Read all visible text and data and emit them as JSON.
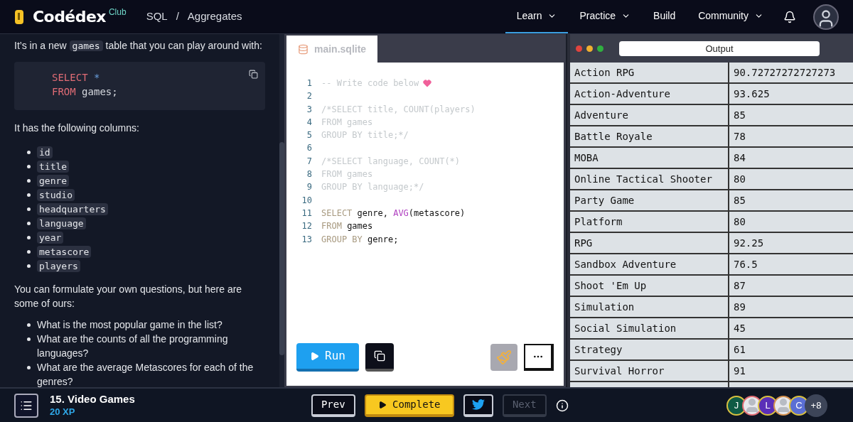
{
  "header": {
    "logo": "Codédex",
    "logo_badge": "Club",
    "breadcrumb": [
      "SQL",
      "Aggregates"
    ],
    "breadcrumb_separator": "/",
    "nav": [
      {
        "label": "Learn",
        "selected": true,
        "dropdown": true
      },
      {
        "label": "Practice",
        "selected": false,
        "dropdown": true
      },
      {
        "label": "Build",
        "selected": false,
        "dropdown": false
      },
      {
        "label": "Community",
        "selected": false,
        "dropdown": true
      }
    ]
  },
  "lesson": {
    "intro": [
      {
        "kind": "text",
        "text": "It’s in a new "
      },
      {
        "kind": "code",
        "text": "games"
      },
      {
        "kind": "text",
        "text": " table that you can play around with:"
      }
    ],
    "code_block": [
      [
        {
          "kind": "keyword",
          "text": "SELECT"
        },
        {
          "kind": "op",
          "text": "*"
        }
      ],
      [
        {
          "kind": "keyword",
          "text": "FROM"
        },
        {
          "kind": "plain",
          "text": "games;"
        }
      ]
    ],
    "columns_intro": "It has the following columns:",
    "columns": [
      "id",
      "title",
      "genre",
      "studio",
      "headquarters",
      "language",
      "year",
      "metascore",
      "players"
    ],
    "questions_intro": "You can formulate your own questions, but here are some of ours:",
    "questions": [
      "What is the most popular game in the list?",
      "What are the counts of all the programming languages?",
      "What are the average Metascores for each of the genres?"
    ]
  },
  "editor": {
    "tab": "main.sqlite",
    "lines": [
      {
        "number": "1",
        "tokens": [
          {
            "kind": "comment",
            "text": "-- Write code below"
          },
          {
            "kind": "heart"
          }
        ]
      },
      {
        "number": "2"
      },
      {
        "number": "3",
        "tokens": [
          {
            "kind": "comment",
            "text": "/*SELECT title, COUNT(players)"
          }
        ]
      },
      {
        "number": "4",
        "tokens": [
          {
            "kind": "comment",
            "text": "FROM games"
          }
        ]
      },
      {
        "number": "5",
        "tokens": [
          {
            "kind": "comment",
            "text": "GROUP BY title;*/"
          }
        ]
      },
      {
        "number": "6"
      },
      {
        "number": "7",
        "tokens": [
          {
            "kind": "comment",
            "text": "/*SELECT language, COUNT(*)"
          }
        ]
      },
      {
        "number": "8",
        "tokens": [
          {
            "kind": "comment",
            "text": "FROM games"
          }
        ]
      },
      {
        "number": "9",
        "tokens": [
          {
            "kind": "comment",
            "text": "GROUP BY language;*/"
          }
        ]
      },
      {
        "number": "10"
      },
      {
        "number": "11",
        "tokens": [
          {
            "kind": "keyword",
            "text": "SELECT"
          },
          {
            "kind": "plain",
            "text": " genre, "
          },
          {
            "kind": "func",
            "text": "AVG"
          },
          {
            "kind": "plain",
            "text": "(metascore)"
          }
        ]
      },
      {
        "number": "12",
        "tokens": [
          {
            "kind": "keyword",
            "text": "FROM"
          },
          {
            "kind": "plain",
            "text": " games"
          }
        ]
      },
      {
        "number": "13",
        "tokens": [
          {
            "kind": "keyword",
            "text": "GROUP BY"
          },
          {
            "kind": "plain",
            "text": " genre;"
          }
        ]
      }
    ],
    "run_button": "Run"
  },
  "output": {
    "title": "Output",
    "rows": [
      [
        "Action RPG",
        "90.72727272727273"
      ],
      [
        "Action-Adventure",
        "93.625"
      ],
      [
        "Adventure",
        "85"
      ],
      [
        "Battle Royale",
        "78"
      ],
      [
        "MOBA",
        "84"
      ],
      [
        "Online Tactical Shooter",
        "80"
      ],
      [
        "Party Game",
        "85"
      ],
      [
        "Platform",
        "80"
      ],
      [
        "RPG",
        "92.25"
      ],
      [
        "Sandbox Adventure",
        "76.5"
      ],
      [
        "Shoot 'Em Up",
        "87"
      ],
      [
        "Simulation",
        "89"
      ],
      [
        "Social Simulation",
        "45"
      ],
      [
        "Strategy",
        "61"
      ],
      [
        "Survival Horror",
        "91"
      ]
    ]
  },
  "footer": {
    "exercise": "15. Video Games",
    "xp": "20 XP",
    "buttons": [
      {
        "kind": "prev",
        "label": "Prev",
        "disabled": false
      },
      {
        "kind": "complete",
        "label": "Complete",
        "disabled": false
      },
      {
        "kind": "twitter",
        "disabled": false
      },
      {
        "kind": "next",
        "label": "Next",
        "disabled": true
      }
    ],
    "avatars": [
      {
        "kind": "letter",
        "text": "J",
        "color": "#0f5a45"
      },
      {
        "kind": "person",
        "color": "#e06c75"
      },
      {
        "kind": "letter",
        "text": "L",
        "color": "#5b2fb8"
      },
      {
        "kind": "person",
        "color": "#d49150"
      },
      {
        "kind": "letter",
        "text": "C",
        "color": "#5b6fd4"
      },
      {
        "kind": "count",
        "text": "+8",
        "color": "#3d4558"
      }
    ]
  }
}
